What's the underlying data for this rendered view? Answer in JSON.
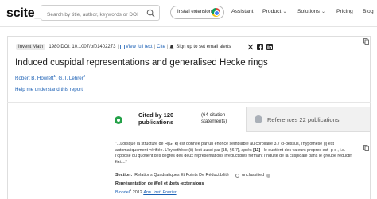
{
  "header": {
    "logo": "scite_",
    "search_placeholder": "Search by title, author, keywords or DOI",
    "install_label": "Install extension!",
    "nav": [
      {
        "label": "Assistant",
        "has_caret": false
      },
      {
        "label": "Product",
        "has_caret": true
      },
      {
        "label": "Solutions",
        "has_caret": true
      },
      {
        "label": "Pricing",
        "has_caret": false
      },
      {
        "label": "Blog",
        "has_caret": false
      }
    ]
  },
  "paper": {
    "journal_tag": "Invent Math",
    "year": "1980",
    "doi": "DOI: 10.1007/bf01402273",
    "full_text_link": "View full text",
    "cite_link": "Cite",
    "alert_text": "Sign up to set email alerts",
    "title": "Induced cuspidal representations and generalised Hecke rings",
    "authors": [
      {
        "name": "Robert B. Howlett",
        "sup": "1"
      },
      {
        "name": "G. I. Lehrer",
        "sup": "2"
      }
    ],
    "help_link": "Help me understand this report"
  },
  "tabs": {
    "cited_by": "Cited by 120 publications",
    "cited_by_line1": "Cited by 120",
    "cited_by_line2": "publications",
    "citation_statements_line1": "(64 citation",
    "citation_statements_line2": "statements)",
    "references": "References 22 publications"
  },
  "citation": {
    "text_before": "\"...Lorsque la structure de H(G, k) est donnée par un énoncé semblable au corollaire 3.7 ci-dessus, l'hypothèse (i) est automatiquement vérifiée. L'hypothèse (ii) l'est aussi par [15, §6.7], après ",
    "ref_bold": "[11]",
    "text_after": " : le quotient des valeurs propres est -p c , i.e. l'opposé du quotient des degrés des deux représentations irréductibles formant l'induite de la cuspidale dans le groupe réductif fini....\"",
    "section_label": "Section:",
    "section_value": "Relations Quadratiques Et Points De Réductibilité",
    "classification": "unclassified",
    "source_title": "Représentation de Weil et \\beta -extensions",
    "source_author": "Blondel",
    "source_sup": "1",
    "source_year": "2012",
    "source_journal": "Ann. Inst. Fourier"
  },
  "colors": {
    "link": "#1a5fb4",
    "cited_icon": "#24a148",
    "refs_tab_bg": "#f1f1f1"
  },
  "icons": [
    "search-icon",
    "chrome-icon",
    "bell-icon",
    "twitter-icon",
    "facebook-icon",
    "linkedin-icon",
    "quote-icon",
    "copy-icon",
    "info-icon"
  ]
}
